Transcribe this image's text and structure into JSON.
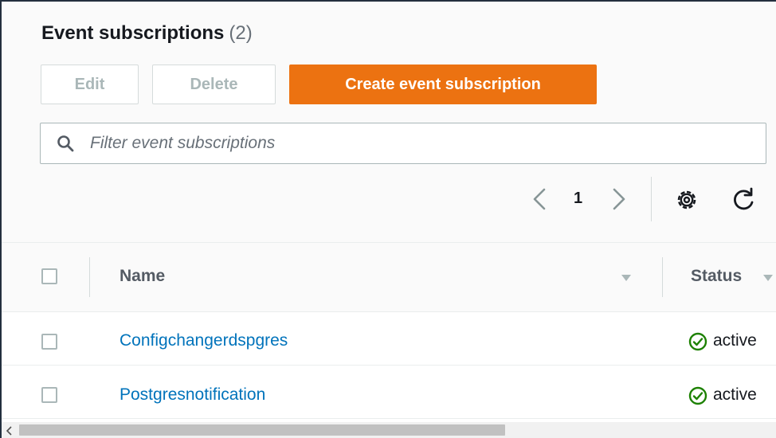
{
  "header": {
    "title": "Event subscriptions",
    "count": "(2)"
  },
  "toolbar": {
    "edit_label": "Edit",
    "delete_label": "Delete",
    "create_label": "Create event subscription"
  },
  "search": {
    "placeholder": "Filter event subscriptions",
    "value": "",
    "icon": "search-icon"
  },
  "pagination": {
    "current_page": "1",
    "prev_icon": "chevron-left-icon",
    "next_icon": "chevron-right-icon"
  },
  "tools": {
    "settings_icon": "gear-icon",
    "refresh_icon": "refresh-icon"
  },
  "table": {
    "columns": [
      {
        "label": "Name",
        "sort_icon": "sort-down-icon"
      },
      {
        "label": "Status",
        "sort_icon": "sort-down-icon"
      }
    ],
    "rows": [
      {
        "name": "Configchangerdspgres",
        "status": "active",
        "status_icon": "check-circle-icon",
        "selected": false
      },
      {
        "name": "Postgresnotification",
        "status": "active",
        "status_icon": "check-circle-icon",
        "selected": false
      }
    ]
  },
  "colors": {
    "primary_button": "#ec7211",
    "link": "#0073bb",
    "success": "#1d8102",
    "disabled_text": "#aab7b8"
  }
}
